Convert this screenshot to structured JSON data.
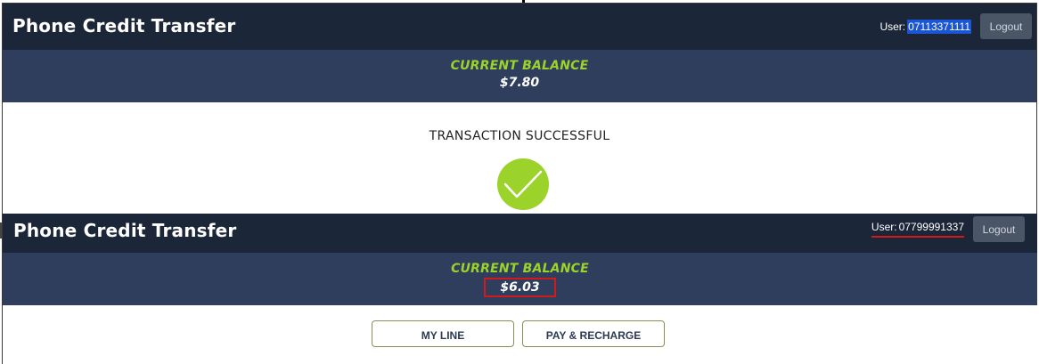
{
  "screen1": {
    "app_title": "Phone Credit Transfer",
    "user_prefix": "User:",
    "user_number": "07113371111",
    "logout_label": "Logout",
    "balance_label": "CURRENT BALANCE",
    "balance_amount": "$7.80",
    "status_message": "TRANSACTION SUCCESSFUL"
  },
  "screen2": {
    "app_title": "Phone Credit Transfer",
    "user_prefix": "User:",
    "user_number": "07799991337",
    "logout_label": "Logout",
    "balance_label": "CURRENT BALANCE",
    "balance_amount": "$6.03",
    "buttons": {
      "my_line": "MY LINE",
      "pay_recharge": "PAY & RECHARGE"
    }
  },
  "colors": {
    "header_bg": "#1c2639",
    "balance_bg": "#2f3e5c",
    "accent_green": "#9bd32a",
    "highlight_red": "#d21a1a",
    "selection_blue": "#1a55d6"
  },
  "icons": {
    "success": "checkmark-circle-icon"
  }
}
